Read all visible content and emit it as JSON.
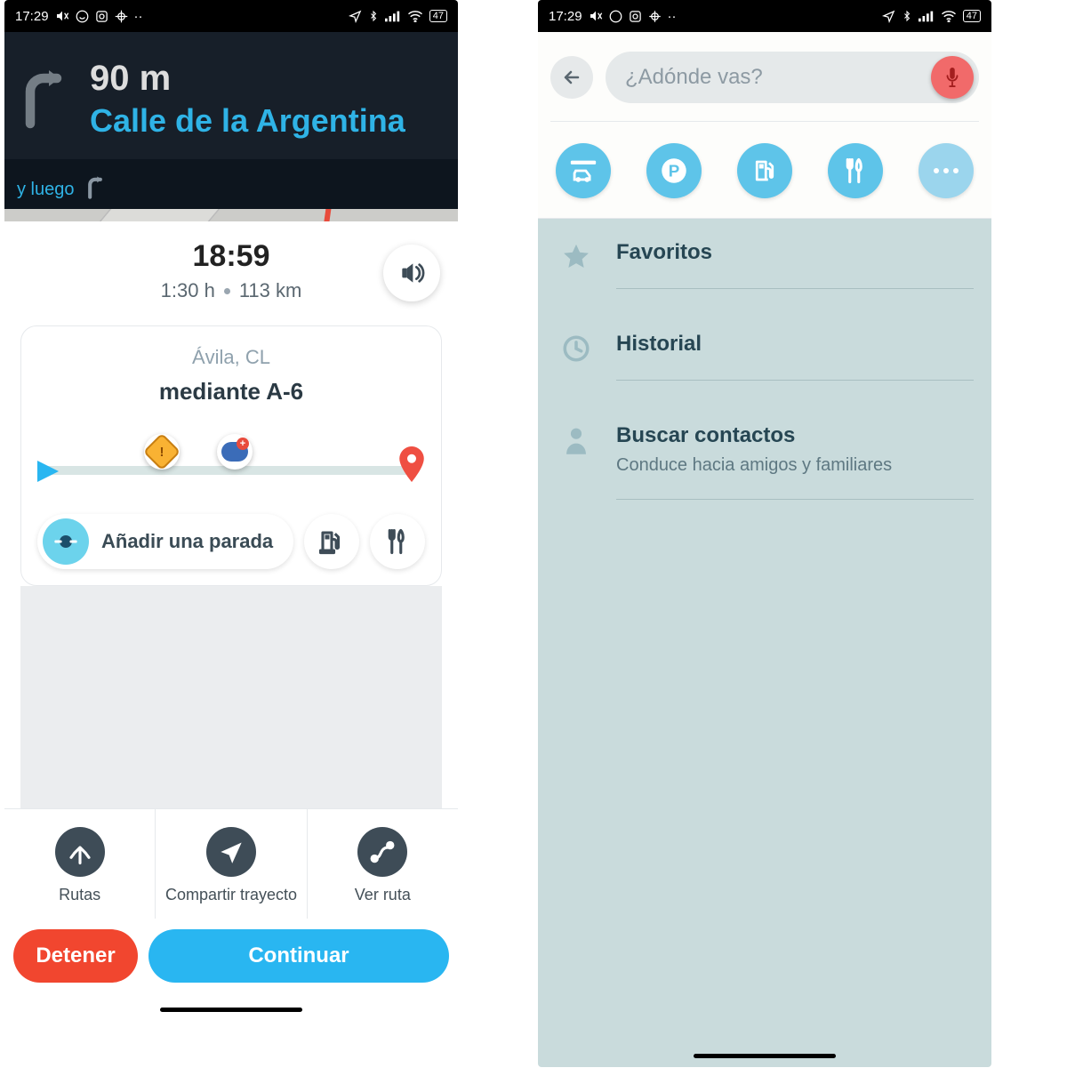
{
  "status": {
    "time": "17:29",
    "battery": "47"
  },
  "left": {
    "nav": {
      "distance": "90 m",
      "street": "Calle de la Argentina",
      "then_label": "y luego"
    },
    "eta": {
      "time": "18:59",
      "duration": "1:30 h",
      "distance": "113 km"
    },
    "route": {
      "destination": "Ávila, CL",
      "via": "mediante A-6"
    },
    "add_stop": "Añadir una parada",
    "actions": {
      "routes": "Rutas",
      "share": "Compartir trayecto",
      "view": "Ver ruta"
    },
    "buttons": {
      "stop": "Detener",
      "continue": "Continuar"
    }
  },
  "right": {
    "search_placeholder": "¿Adónde vas?",
    "items": {
      "favorites": "Favoritos",
      "history": "Historial",
      "contacts_title": "Buscar contactos",
      "contacts_sub": "Conduce hacia amigos y familiares"
    }
  }
}
